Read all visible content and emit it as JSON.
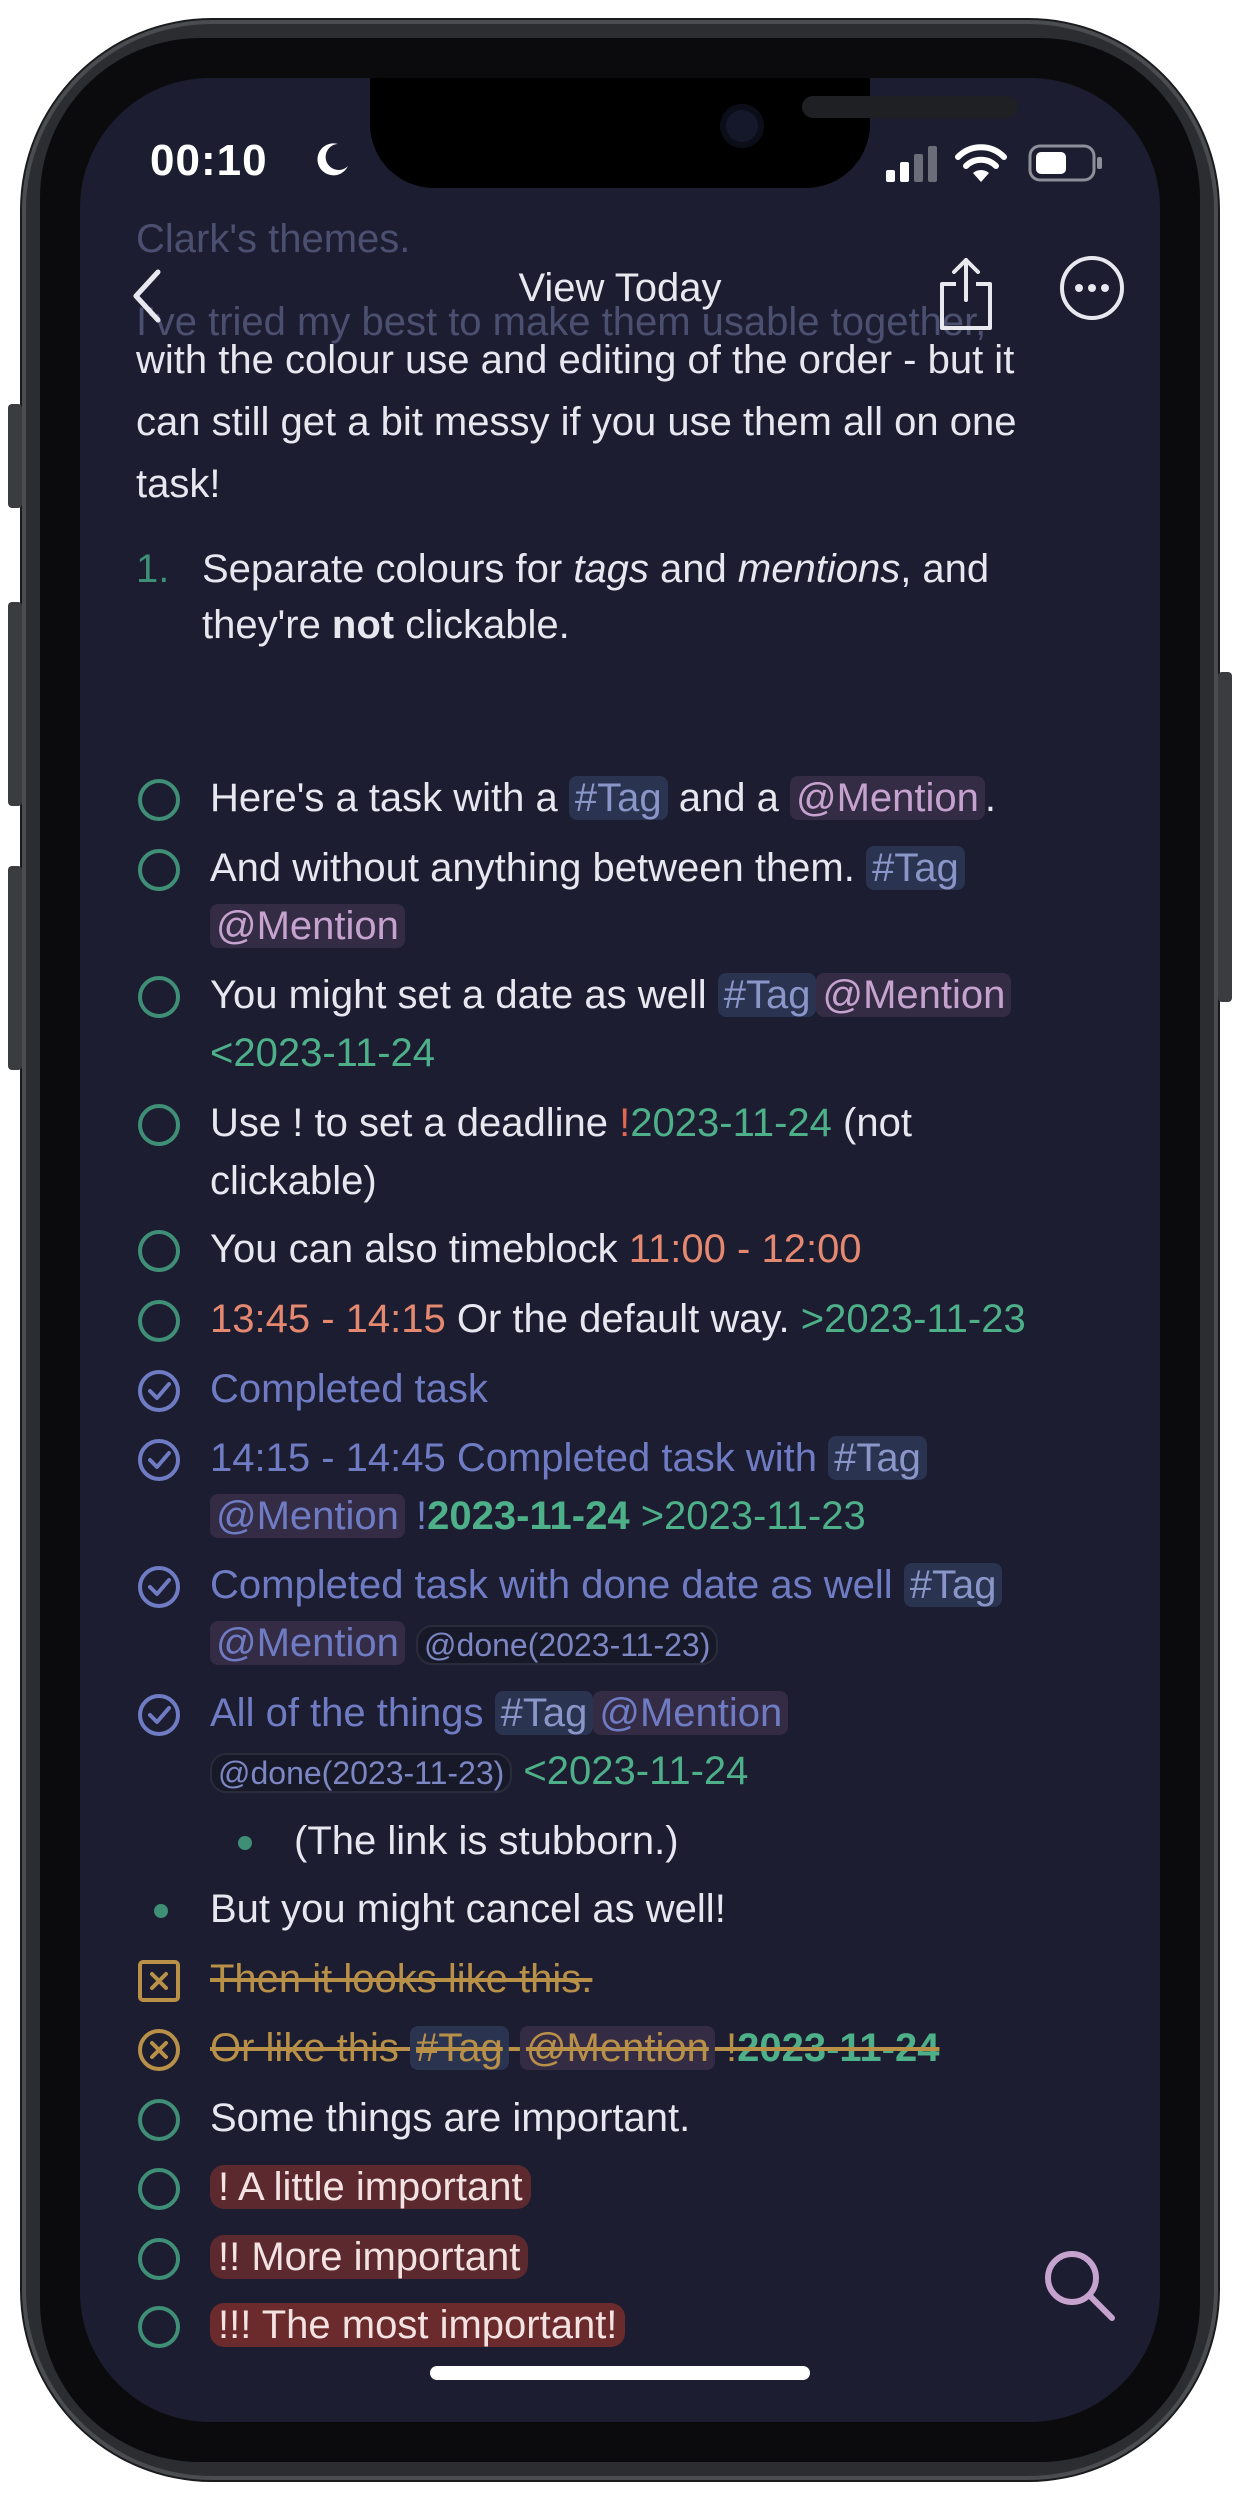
{
  "status_bar": {
    "time": "00:10"
  },
  "nav": {
    "title": "View Today"
  },
  "faded_lines": [
    "Clark's themes.",
    "I've tried my best to make them usable together,"
  ],
  "intro_lines": [
    "with the colour use and editing of the order - but it",
    "can still get a bit messy if you use them all on one",
    "task!"
  ],
  "list_item": {
    "number": "1.",
    "a": "Separate colours for ",
    "b": "tags",
    "c": " and ",
    "d": "mentions",
    "e": ", and",
    "f": "they're ",
    "g": "not",
    "h": " clickable."
  },
  "tasks": {
    "t1": {
      "text": "Here's a task with a ",
      "tag": "#Tag",
      "mid": " and a ",
      "mention": "@Mention",
      "end": "."
    },
    "t2": {
      "text": "And without anything between them. ",
      "tag": "#Tag",
      "mention": "@Mention"
    },
    "t3": {
      "text": "You might set a date as well ",
      "tag": "#Tag",
      "mention": "@Mention",
      "date": "<2023-11-24"
    },
    "t4": {
      "text": "Use ! to set a deadline ",
      "bang": "!",
      "date": "2023-11-24",
      "end": " (not",
      "end2": "clickable)"
    },
    "t5": {
      "text": "You can also timeblock ",
      "time": "11:00 - 12:00"
    },
    "t6": {
      "time": "13:45 - 14:15",
      "text": " Or the default way. ",
      "date": ">2023-11-23"
    },
    "t7": {
      "text": "Completed task"
    },
    "t8": {
      "text": "14:15 - 14:45 Completed task with ",
      "tag": "#Tag",
      "mention": "@Mention",
      "bang": "!",
      "deadline": "2023-11-24",
      "date": " >2023-11-23"
    },
    "t9": {
      "text": "Completed task with done date as well ",
      "tag": "#Tag",
      "mention": "@Mention",
      "done": "@done(2023-11-23)"
    },
    "t10": {
      "text": "All of the things ",
      "tag": "#Tag",
      "mention": "@Mention",
      "done": "@done(2023-11-23)",
      "date": " <2023-11-24"
    },
    "b1": {
      "text": "(The link is stubborn.)"
    },
    "b2": {
      "text": "But you might cancel as well!"
    },
    "c1": {
      "text": "Then it looks like this."
    },
    "c2": {
      "text": "Or like this ",
      "tag": "#Tag",
      "mention": "@Mention",
      "bang": " !",
      "deadline": "2023-11-24"
    },
    "i0": {
      "text": "Some things are important."
    },
    "i1": {
      "text": "! A little important"
    },
    "i2": {
      "text": "!! More important"
    },
    "i3": {
      "text": "!!! The most important!"
    }
  },
  "icons": [
    "back-icon",
    "share-icon",
    "more-icon",
    "search-icon",
    "moon-icon",
    "signal-icon",
    "wifi-icon",
    "battery-icon"
  ],
  "colors": {
    "background": "#1c1d30",
    "accent_green": "#3f8f77",
    "completed": "#6f7cc4",
    "cancelled": "#b89048",
    "tag": "#8a95c8",
    "mention": "#c6a3cf",
    "time": "#e58870",
    "priority_bg": "#5c2a2e"
  }
}
